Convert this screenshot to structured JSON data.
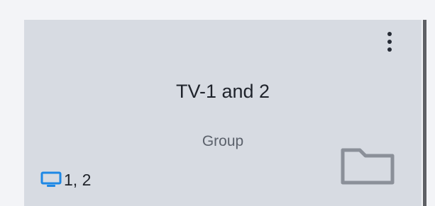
{
  "card": {
    "title": "TV-1 and 2",
    "type": "Group",
    "screens": "1, 2",
    "menu_icon": "more-vertical-icon",
    "screen_icon": "monitor-icon",
    "folder_icon": "folder-icon"
  },
  "colors": {
    "background": "#f3f4f7",
    "card": "#d7dbe2",
    "title": "#1f232b",
    "subtitle": "#5b616b",
    "accent": "#1e88e5",
    "folder": "#8b9099"
  }
}
